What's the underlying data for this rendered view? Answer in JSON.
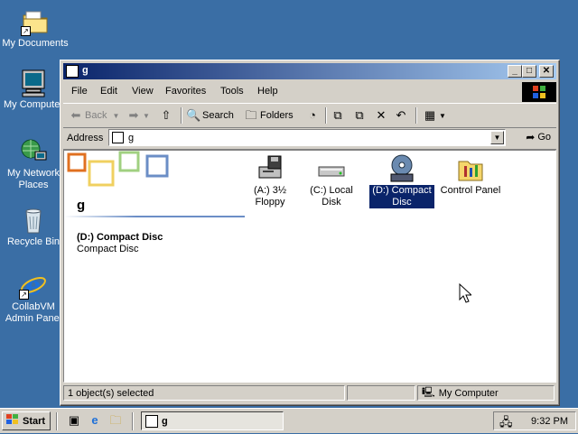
{
  "desktop": {
    "icons": [
      {
        "label": "My Documents"
      },
      {
        "label": "My Computer"
      },
      {
        "label": "My Network Places"
      },
      {
        "label": "Recycle Bin"
      },
      {
        "label": "CollabVM Admin Panel"
      }
    ]
  },
  "window": {
    "title": "g",
    "controls": {
      "minimize": "_",
      "maximize": "□",
      "close": "✕"
    },
    "menu": [
      "File",
      "Edit",
      "View",
      "Favorites",
      "Tools",
      "Help"
    ],
    "toolbar": {
      "back": "Back",
      "search": "Search",
      "folders": "Folders"
    },
    "address": {
      "label": "Address",
      "value": "g",
      "go": "Go"
    },
    "folder_title": "g",
    "selection": {
      "name": "(D:) Compact Disc",
      "type": "Compact Disc"
    },
    "items": [
      {
        "label": "(A:) 3½ Floppy",
        "icon": "floppy-drive-icon"
      },
      {
        "label": "(C:) Local Disk",
        "icon": "hard-disk-icon"
      },
      {
        "label": "(D:) Compact Disc",
        "icon": "cd-drive-icon",
        "selected": true
      },
      {
        "label": "Control Panel",
        "icon": "control-panel-icon"
      }
    ],
    "status": {
      "left": "1 object(s) selected",
      "right": "My Computer"
    }
  },
  "taskbar": {
    "start": "Start",
    "task": "g",
    "clock": "9:32 PM"
  },
  "colors": {
    "desktop": "#3a6ea5",
    "title_active_start": "#0a246a",
    "title_active_end": "#a6caf0",
    "selection": "#0a246a"
  }
}
